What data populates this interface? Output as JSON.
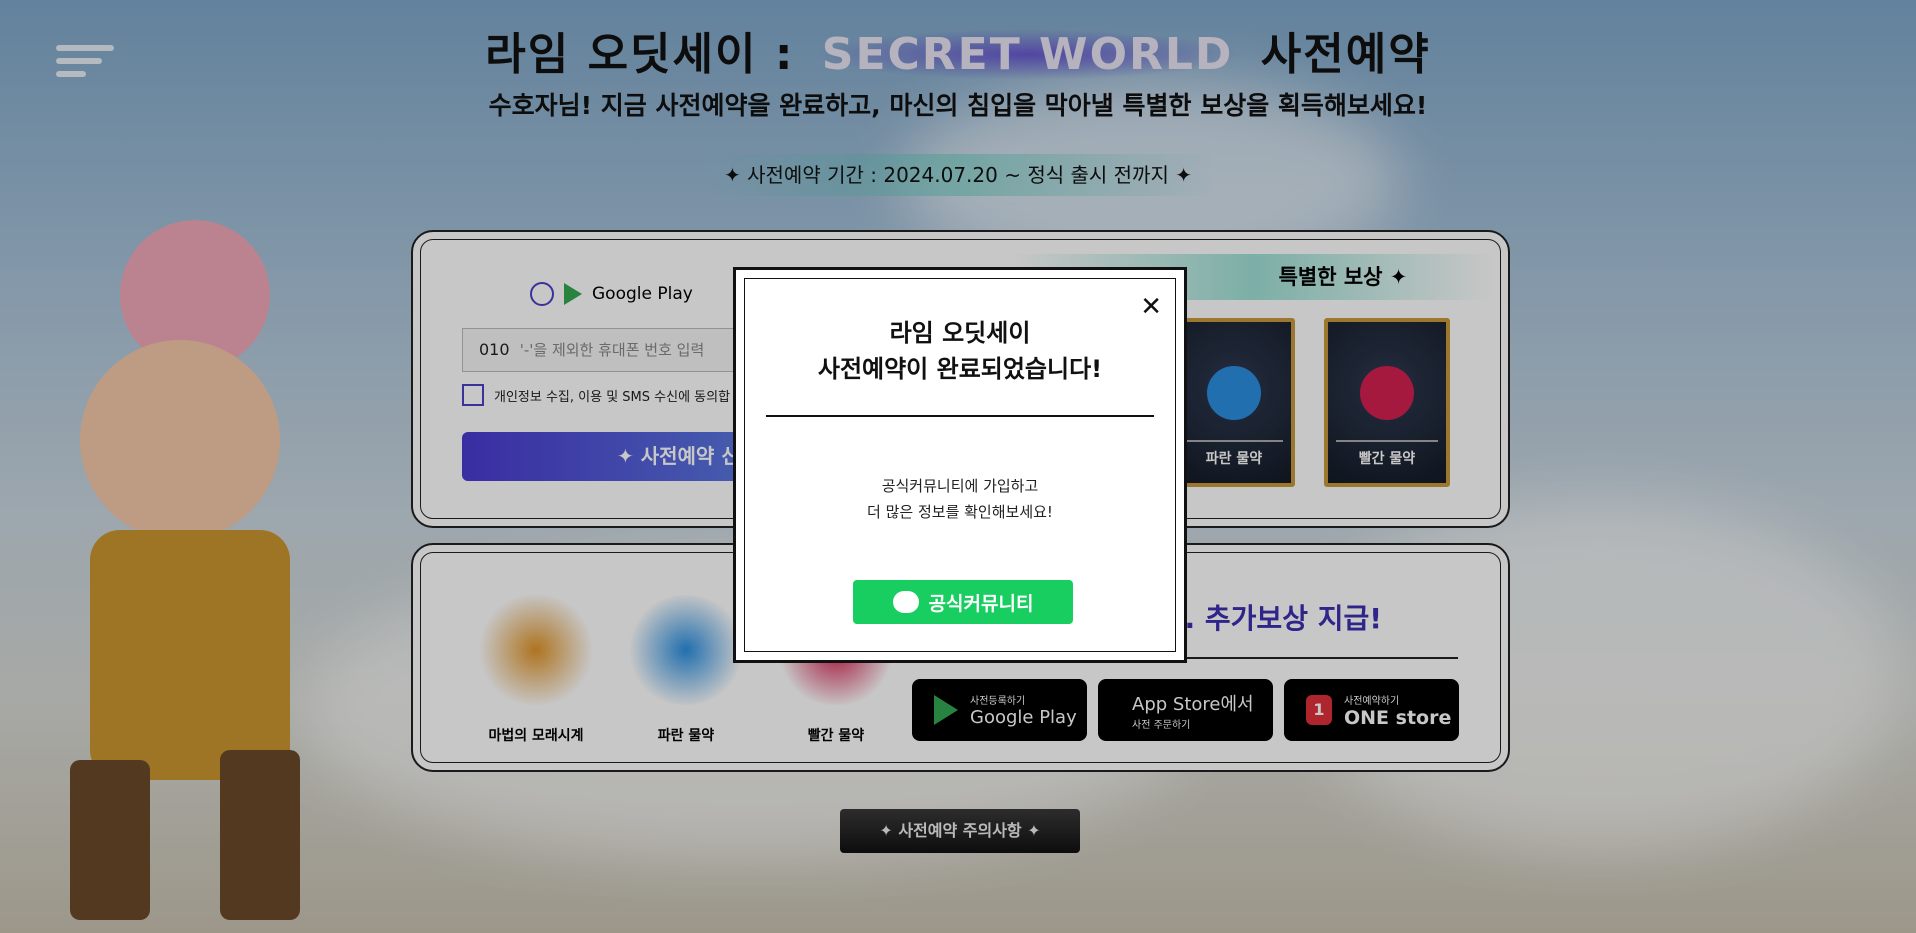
{
  "header": {
    "title_pre": "라임 오딧세이 :",
    "title_highlight": "SECRET WORLD",
    "title_post": "사전예약",
    "subtitle": "수호자님! 지금 사전예약을 완료하고, 마신의 침입을 막아낼 특별한 보상을 획득해보세요!",
    "period": "✦  사전예약 기간 : 2024.07.20 ~ 정식 출시 전까지  ✦"
  },
  "form": {
    "platform": "Google Play",
    "phone_prefix": "010",
    "phone_placeholder": "'-'을 제외한 휴대폰 번호 입력",
    "consent": "개인정보 수집, 이용 및 SMS 수신에 동의합",
    "submit": "✦ 사전예약 신"
  },
  "rewards": {
    "title": "특별한 보상 ✦",
    "cards": [
      {
        "label": "파란 물약"
      },
      {
        "label": "빨간 물약"
      }
    ]
  },
  "bonus": {
    "items": [
      {
        "label": "마법의 모래시계"
      },
      {
        "label": "파란 물약"
      },
      {
        "label": "빨간 물약"
      }
    ],
    "headline": "]. 추가보상 지급!",
    "stores": [
      {
        "small": "사전등록하기",
        "big": "Google Play"
      },
      {
        "big": "App Store에서",
        "small": "사전 주문하기"
      },
      {
        "small": "사전예약하기",
        "big": "ONE store"
      }
    ]
  },
  "notice_button": "✦  사전예약 주의사항  ✦",
  "modal": {
    "title_line1": "라임 오딧세이",
    "title_line2": "사전예약이 완료되었습니다!",
    "body_line1": "공식커뮤니티에 가입하고",
    "body_line2": "더 많은 정보를 확인해보세요!",
    "community_button": "공식커뮤니티",
    "close": "✕"
  }
}
